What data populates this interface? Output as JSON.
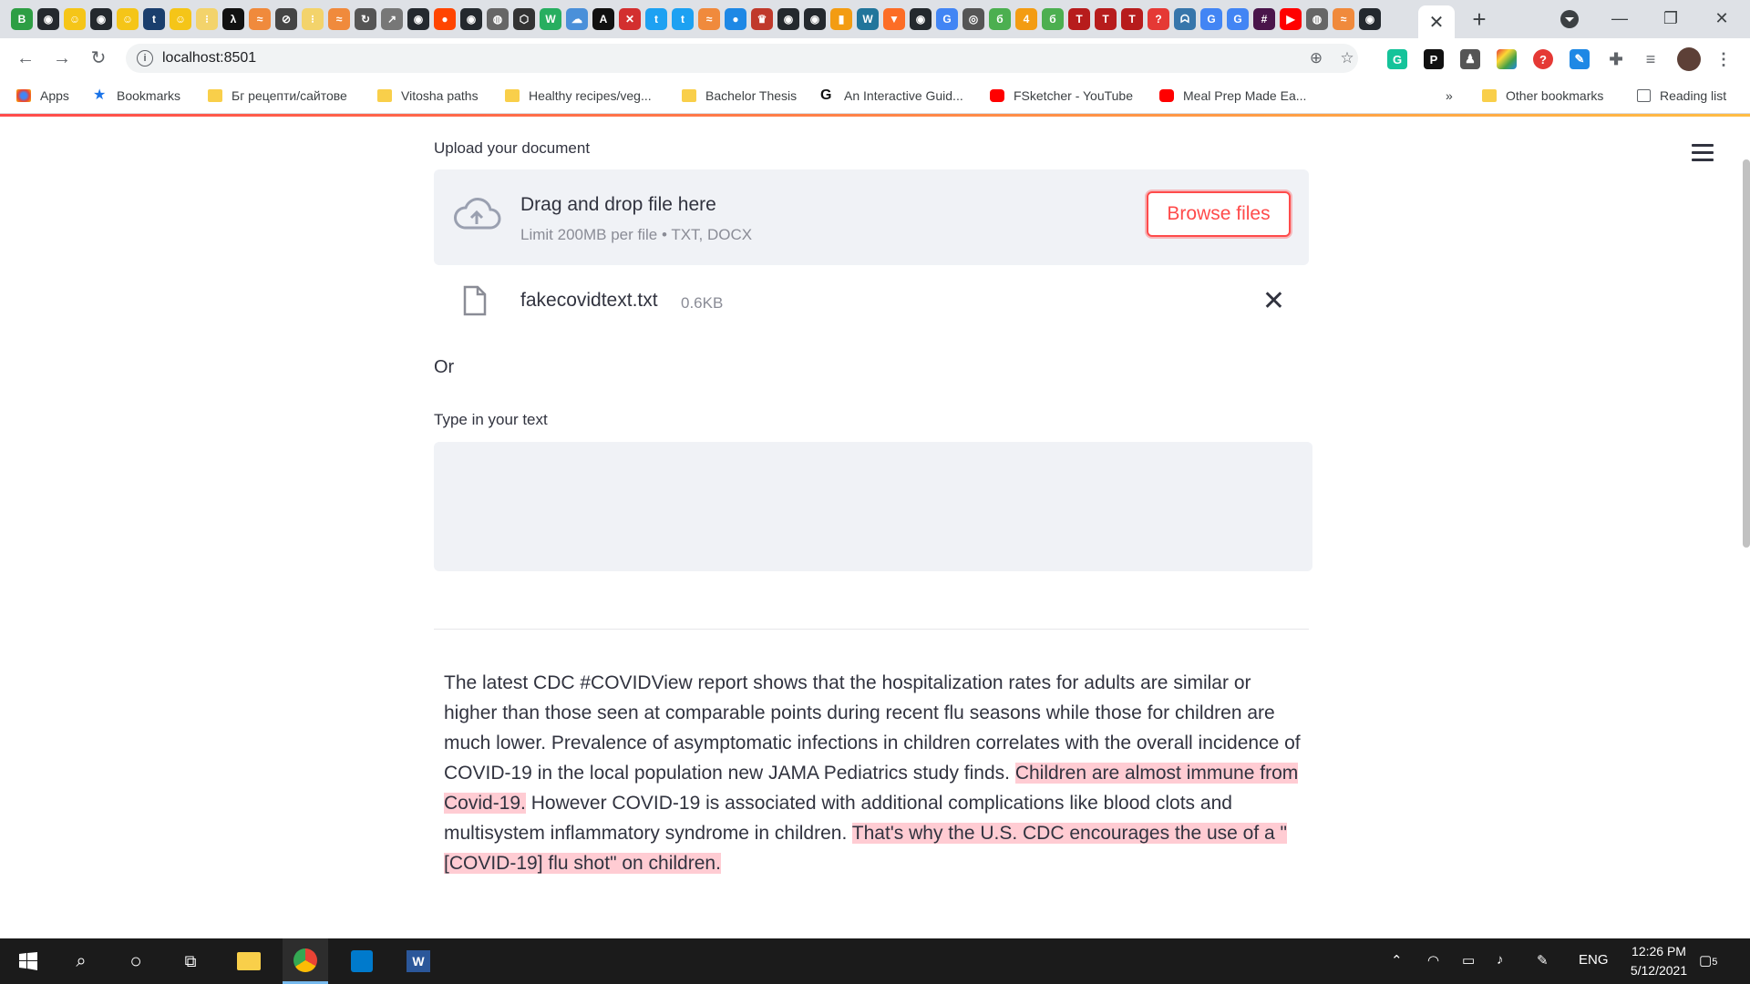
{
  "browser": {
    "url": "localhost:8501",
    "tab_close": "✕",
    "new_tab": "+",
    "bookmarks": [
      {
        "label": "Apps",
        "icon": "apps-grid-icon"
      },
      {
        "label": "Bookmarks",
        "icon": "star-icon"
      },
      {
        "label": "Бг рецепти/сайтове",
        "icon": "folder-icon"
      },
      {
        "label": "Vitosha paths",
        "icon": "folder-icon"
      },
      {
        "label": "Healthy recipes/veg...",
        "icon": "folder-icon"
      },
      {
        "label": "Bachelor Thesis",
        "icon": "folder-icon"
      },
      {
        "label": "An Interactive Guid...",
        "icon": "g-letter-icon"
      },
      {
        "label": "FSketcher - YouTube",
        "icon": "youtube-icon"
      },
      {
        "label": "Meal Prep Made Ea...",
        "icon": "youtube-icon"
      }
    ],
    "bookmarks_overflow": "»",
    "other_bookmarks": "Other bookmarks",
    "reading_list": "Reading list"
  },
  "uploader": {
    "label": "Upload your document",
    "drag_text": "Drag and drop file here",
    "limit_text": "Limit 200MB per file • TXT, DOCX",
    "browse_label": "Browse files",
    "file_name": "fakecovidtext.txt",
    "file_size": "0.6KB"
  },
  "or_text": "Or",
  "text_input": {
    "label": "Type in your text",
    "value": ""
  },
  "result": {
    "segments": [
      {
        "text": "The latest CDC #COVIDView report shows that the hospitalization rates for adults are similar or higher than those seen at comparable points during recent flu seasons while those for children are much lower. Prevalence of asymptomatic infections in children correlates with the overall incidence of COVID-19 in the local population new JAMA Pediatrics study finds. ",
        "highlight": false
      },
      {
        "text": "Children are almost immune from Covid-19.",
        "highlight": true
      },
      {
        "text": " However COVID-19 is associated with additional complications like blood clots and multisystem inflammatory syndrome in children. ",
        "highlight": false
      },
      {
        "text": "That's why the U.S. CDC encourages the use of a \"[COVID-19] flu shot\" on children.",
        "highlight": true
      }
    ],
    "highlight_color": "#ffccd3"
  },
  "colors": {
    "accent": "#ff4b4b",
    "uploader_bg": "#f0f2f6"
  },
  "taskbar": {
    "time": "12:26 PM",
    "date": "5/12/2021",
    "language": "ENG",
    "notifications": "5"
  }
}
